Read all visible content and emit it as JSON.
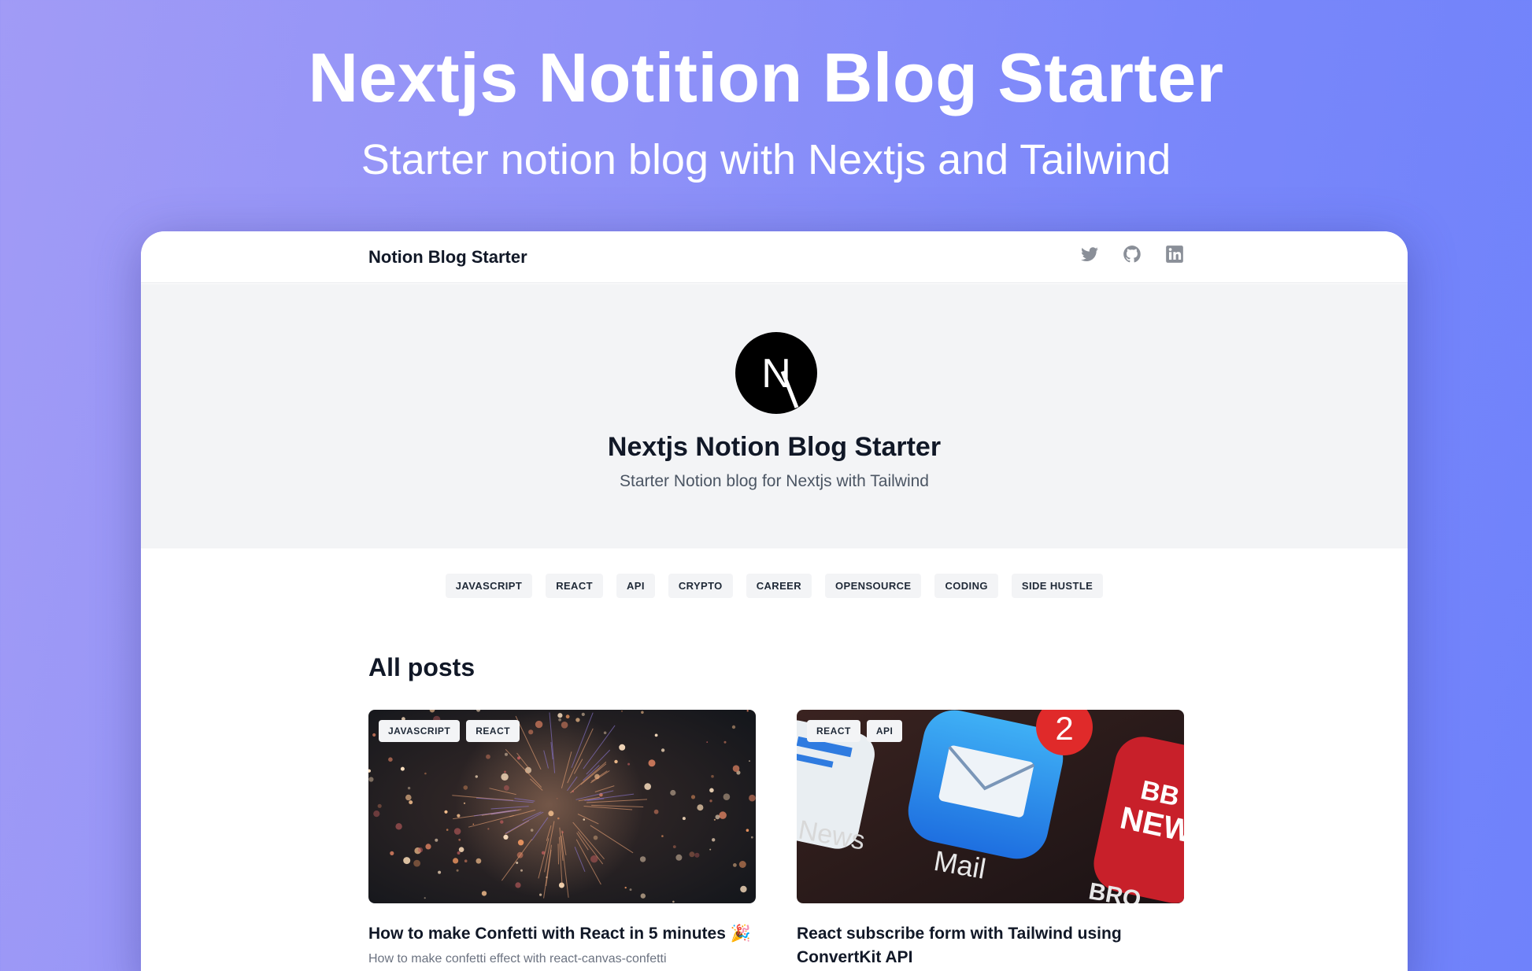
{
  "hero": {
    "title": "Nextjs Notition Blog Starter",
    "subtitle": "Starter notion blog with Nextjs and Tailwind"
  },
  "navbar": {
    "brand": "Notion Blog Starter",
    "social": [
      {
        "icon": "twitter-icon"
      },
      {
        "icon": "github-icon"
      },
      {
        "icon": "linkedin-icon"
      }
    ]
  },
  "profile": {
    "avatar_letter": "N",
    "title": "Nextjs Notion Blog Starter",
    "description": "Starter Notion blog for Nextjs with Tailwind"
  },
  "tags": [
    "JAVASCRIPT",
    "REACT",
    "API",
    "CRYPTO",
    "CAREER",
    "OPENSOURCE",
    "CODING",
    "SIDE HUSTLE"
  ],
  "posts_section": {
    "title": "All posts"
  },
  "posts": [
    {
      "tags": [
        "JAVASCRIPT",
        "REACT"
      ],
      "title": "How to make Confetti with React in 5 minutes 🎉",
      "excerpt": "How to make confetti effect with react-canvas-confetti",
      "image": "fireworks-photo"
    },
    {
      "tags": [
        "REACT",
        "API"
      ],
      "title": "React subscribe form with Tailwind using ConvertKit API",
      "excerpt": "",
      "image": "mail-app-icon-photo",
      "image_texts": {
        "badge": "2",
        "left": "News",
        "center": "Mail",
        "right_top": "BB",
        "right_mid": "NEW",
        "right_bottom": "BRO"
      }
    }
  ],
  "colors": {
    "background_start": "#a19bf6",
    "background_end": "#6f82fb",
    "text_dark": "#111827",
    "tag_bg": "#f3f4f6",
    "panel_bg": "#f3f4f6"
  }
}
